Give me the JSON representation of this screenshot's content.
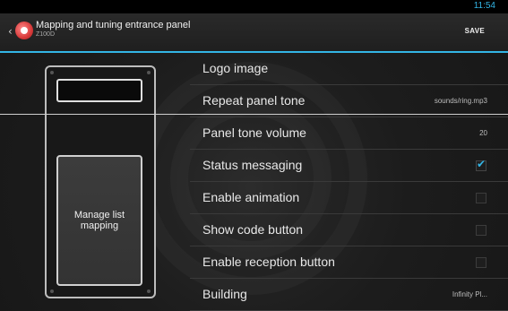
{
  "status": {
    "time": "11:54"
  },
  "actionbar": {
    "title": "Mapping and tuning entrance panel",
    "subtitle": "Z100D",
    "save_label": "SAVE"
  },
  "panel": {
    "manage_label": "Manage list mapping"
  },
  "settings": [
    {
      "label": "Logo image",
      "value": ""
    },
    {
      "label": "Repeat panel tone",
      "value": "sounds/ring.mp3"
    },
    {
      "label": "Panel tone volume",
      "value": "20"
    },
    {
      "label": "Status messaging",
      "checked": true
    },
    {
      "label": "Enable animation",
      "checked": false
    },
    {
      "label": "Show code button",
      "checked": false
    },
    {
      "label": "Enable reception button",
      "checked": false
    },
    {
      "label": "Building",
      "value": "Infinity Pl..."
    }
  ],
  "colors": {
    "accent": "#33b5e5"
  }
}
